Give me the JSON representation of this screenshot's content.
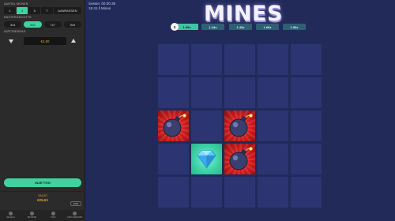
{
  "sidebar": {
    "mines_count": {
      "label": "AANTAL MIJNEN",
      "options": [
        "1",
        "3",
        "5",
        "7",
        "AANPASSEN"
      ],
      "selected_index": 1
    },
    "board_size": {
      "label": "RASTERGROOTTE",
      "options": [
        "3x3",
        "5x5",
        "7x7",
        "9x9"
      ],
      "selected_index": 1
    },
    "bet": {
      "label": "INZETBEDRAG",
      "value": "€2,00"
    },
    "play_button": "INZETTEN",
    "balance": {
      "label": "SALDO",
      "value": "€25,61",
      "currency": "EUR"
    },
    "nav": [
      {
        "label": "REGELS",
        "icon": "rules-icon"
      },
      {
        "label": "BROWSE",
        "icon": "browse-icon"
      },
      {
        "label": "INFO",
        "icon": "info-icon"
      },
      {
        "label": "GESCHIEDENIS",
        "icon": "history-icon"
      }
    ]
  },
  "session": {
    "time_line": "Sessie: 00:00:36",
    "clock_mines": "15:41 ‖ Mines"
  },
  "game": {
    "title": "MINES",
    "step": "3",
    "multipliers": [
      "1.09x",
      "1.24x",
      "1.43x",
      "1.66x",
      "1.93x"
    ],
    "current_multiplier_index": 0,
    "grid": [
      [
        "empty",
        "empty",
        "empty",
        "empty",
        "empty"
      ],
      [
        "empty",
        "empty",
        "empty",
        "empty",
        "empty"
      ],
      [
        "bomb",
        "empty",
        "bomb",
        "empty",
        "empty"
      ],
      [
        "empty",
        "gem",
        "bomb",
        "empty",
        "empty"
      ],
      [
        "empty",
        "empty",
        "empty",
        "empty",
        "empty"
      ]
    ]
  },
  "colors": {
    "accent": "#3fd39f",
    "background": "#222a5a",
    "tile": "#2c3472",
    "bomb_tile": "#d41e1e",
    "balance_text": "#e0a53c"
  }
}
